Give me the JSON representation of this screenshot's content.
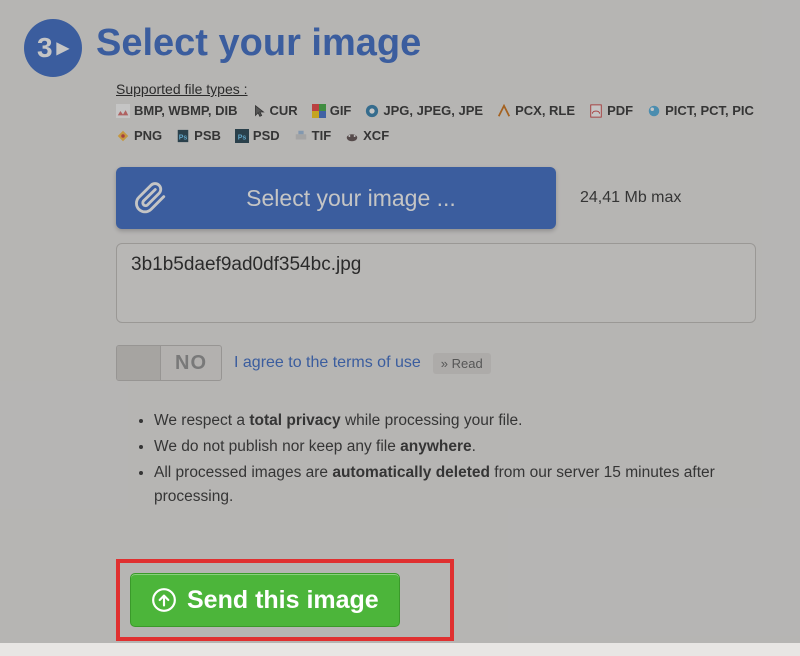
{
  "step": {
    "number": "3",
    "title": "Select your image"
  },
  "supported": {
    "label": "Supported file types :",
    "items": [
      "BMP, WBMP, DIB",
      "CUR",
      "GIF",
      "JPG, JPEG, JPE",
      "PCX, RLE",
      "PDF",
      "PICT, PCT, PIC",
      "PNG",
      "PSB",
      "PSD",
      "TIF",
      "XCF"
    ]
  },
  "upload": {
    "button_label": "Select your image ...",
    "max_size": "24,41 Mb max",
    "filename": "3b1b5daef9ad0df354bc.jpg"
  },
  "consent": {
    "toggle_state": "NO",
    "label": "I agree to the terms of use",
    "read_label": "» Read"
  },
  "privacy": {
    "items": [
      {
        "pre": "We respect a ",
        "bold": "total privacy",
        "post": " while processing your file."
      },
      {
        "pre": "We do not publish nor keep any file ",
        "bold": "anywhere",
        "post": "."
      },
      {
        "pre": "All processed images are ",
        "bold": "automatically deleted",
        "post": " from our server 15 minutes after processing."
      }
    ]
  },
  "send": {
    "label": "Send this image"
  }
}
